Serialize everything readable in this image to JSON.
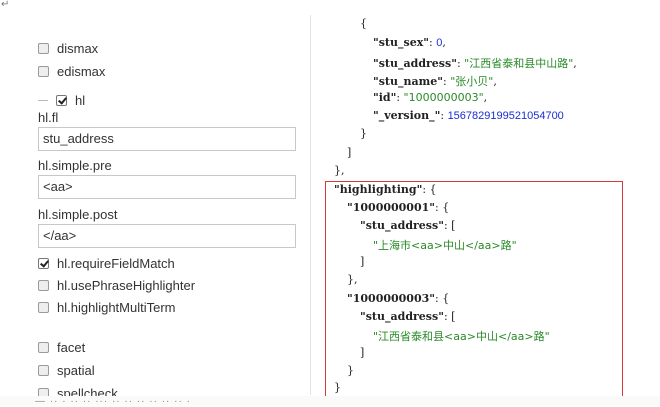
{
  "corner_mark": "↵",
  "left": {
    "dismax": "dismax",
    "edismax": "edismax",
    "hl": "hl",
    "hl_fl_label": "hl.fl",
    "hl_fl_value": "stu_address",
    "hl_simple_pre_label": "hl.simple.pre",
    "hl_simple_pre_value": "<aa>",
    "hl_simple_post_label": "hl.simple.post",
    "hl_simple_post_value": "</aa>",
    "require_field_match": "hl.requireFieldMatch",
    "use_phrase_highlighter": "hl.usePhraseHighlighter",
    "highlight_multi_term": "hl.highlightMultiTerm",
    "facet": "facet",
    "spatial": "spatial",
    "spellcheck": "spellcheck",
    "checked": {
      "dismax": false,
      "edismax": false,
      "hl": true,
      "require_field_match": true,
      "use_phrase_highlighter": false,
      "highlight_multi_term": false,
      "facet": false,
      "spatial": false,
      "spellcheck": false
    }
  },
  "json": {
    "open_brace": "{",
    "sex_key": "\"stu_sex\"",
    "sex_val": "0",
    "address_key": "\"stu_address\"",
    "address_val": "\"江西省泰和县中山路\"",
    "name_key": "\"stu_name\"",
    "name_val": "\"张小贝\"",
    "id_key": "\"id\"",
    "id_val": "\"1000000003\"",
    "version_key": "\"_version_\"",
    "version_val": "1567829199521054700",
    "close_brace": "}",
    "close_bracket": "]",
    "close_obj_comma": "},",
    "highlighting_key": "\"highlighting\"",
    "h1_key": "\"1000000001\"",
    "h1_field": "\"stu_address\"",
    "h1_val": "\"上海市<aa>中山</aa>路\"",
    "h2_key": "\"1000000003\"",
    "h2_field": "\"stu_address\"",
    "h2_val": "\"江西省泰和县<aa>中山</aa>路\""
  },
  "bottom_text": "— ·· · ·· ·· ··· ·· ·· ·· ·· ·· ·· ·"
}
